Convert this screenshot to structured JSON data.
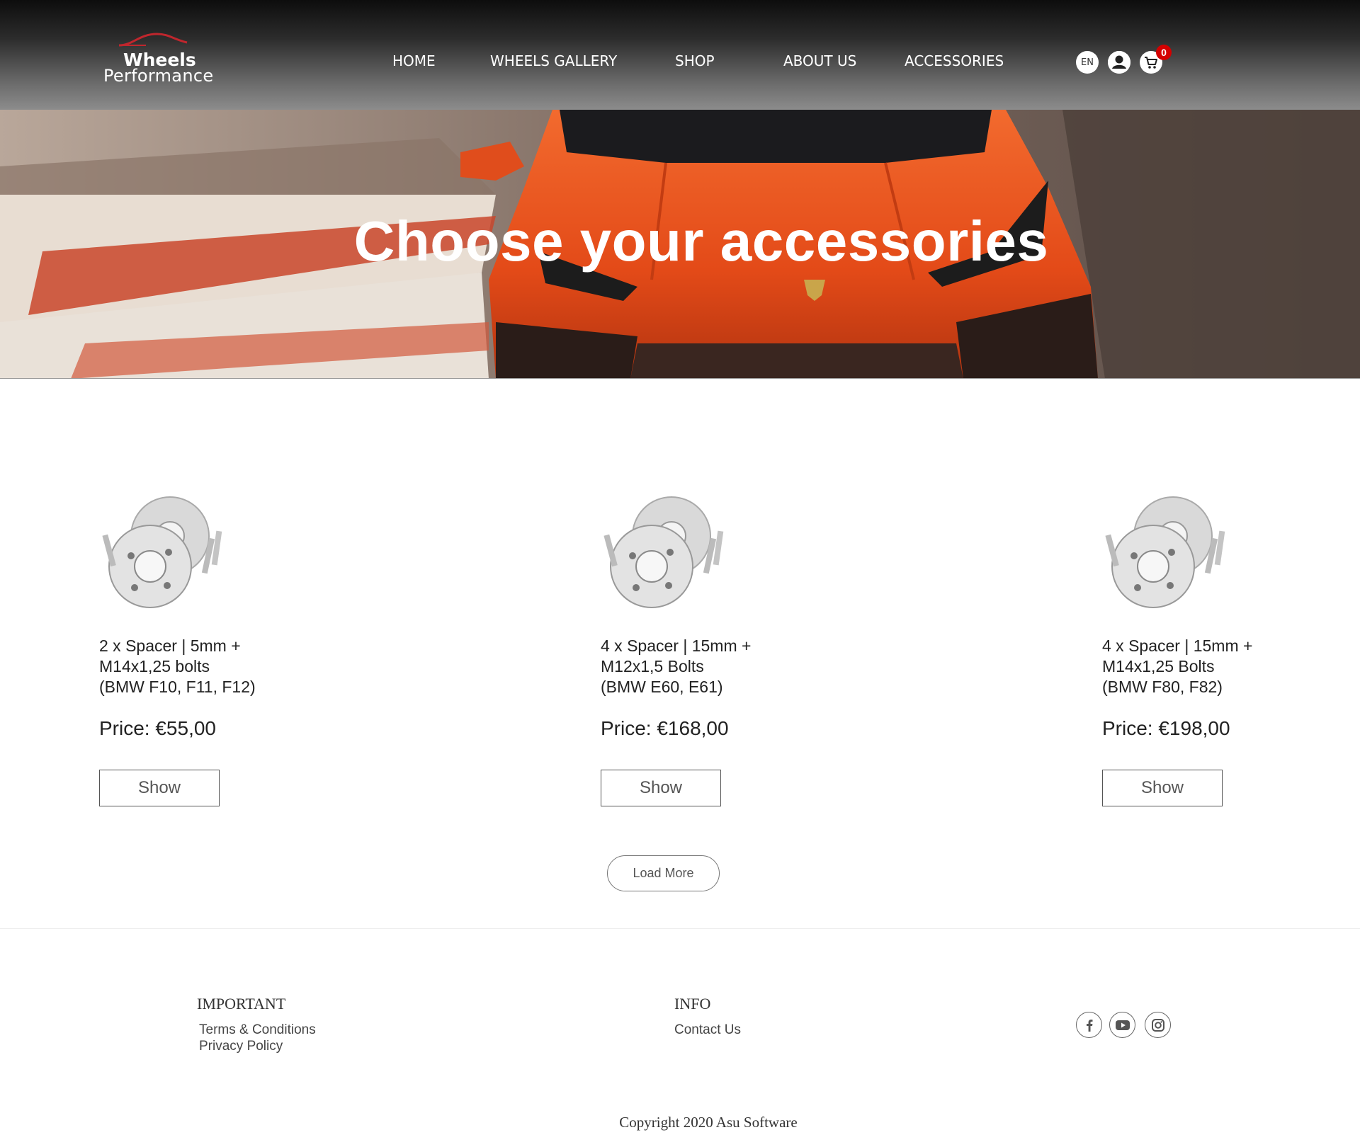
{
  "header": {
    "logo": {
      "line1": "Wheels",
      "line2": "Performance"
    },
    "nav": [
      {
        "label": "HOME"
      },
      {
        "label": "WHEELS GALLERY"
      },
      {
        "label": "SHOP"
      },
      {
        "label": "ABOUT US"
      },
      {
        "label": "ACCESSORIES"
      }
    ],
    "language": "EN",
    "cart_count": "0"
  },
  "hero": {
    "title": "Choose your accessories"
  },
  "products": [
    {
      "name_lines": [
        "2 x Spacer | 5mm +",
        "M14x1,25 bolts",
        "(BMW F10, F11, F12)"
      ],
      "price": "Price: €55,00",
      "button": "Show"
    },
    {
      "name_lines": [
        "4 x Spacer | 15mm +",
        "M12x1,5 Bolts",
        "(BMW E60, E61)"
      ],
      "price": "Price: €168,00",
      "button": "Show"
    },
    {
      "name_lines": [
        "4 x Spacer | 15mm +",
        "M14x1,25 Bolts",
        "(BMW F80, F82)"
      ],
      "price": "Price: €198,00",
      "button": "Show"
    }
  ],
  "load_more": "Load More",
  "footer": {
    "important": {
      "heading": "IMPORTANT",
      "links": [
        "Terms & Conditions",
        "Privacy Policy"
      ]
    },
    "info": {
      "heading": "INFO",
      "links": [
        "Contact Us"
      ]
    },
    "social": [
      "facebook-icon",
      "youtube-icon",
      "instagram-icon"
    ],
    "copyright": "Copyright 2020 Asu Software"
  },
  "colors": {
    "cart_badge": "#d40000",
    "car": "#e8501c",
    "logo_arc": "#c0262d"
  }
}
